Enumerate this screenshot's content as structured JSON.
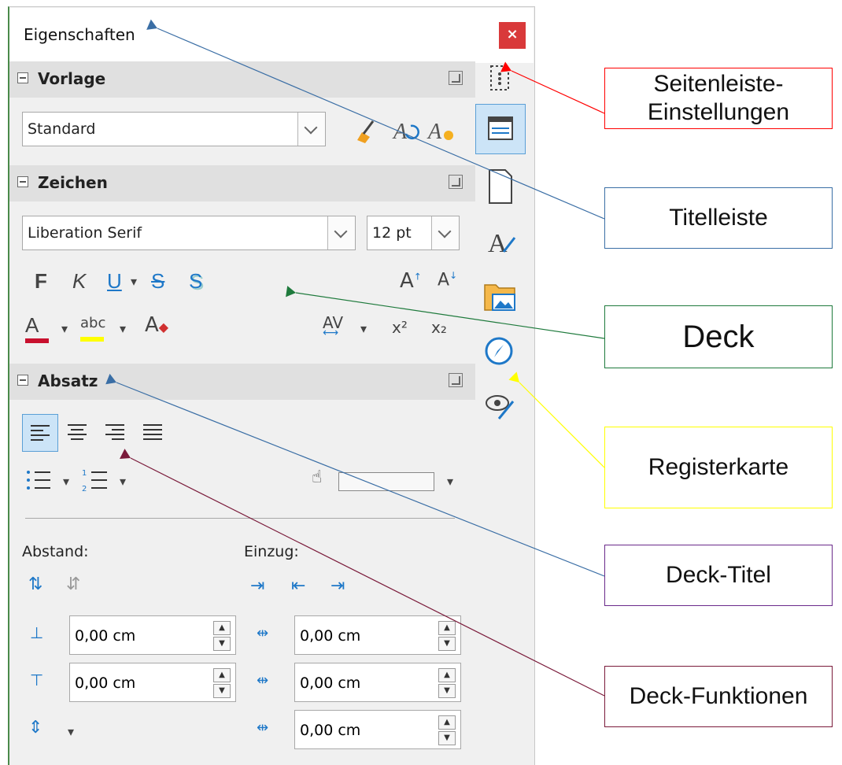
{
  "window": {
    "title": "Eigenschaften",
    "close_label": "×"
  },
  "sections": {
    "vorlage": {
      "label": "Vorlage",
      "style_value": "Standard"
    },
    "zeichen": {
      "label": "Zeichen",
      "font_value": "Liberation Serif",
      "size_value": "12 pt",
      "bold": "F",
      "italic": "K",
      "underline": "U",
      "strike": "S",
      "shadow": "S",
      "superscript": "x²",
      "subscript": "x₂"
    },
    "absatz": {
      "label": "Absatz",
      "abstand_label": "Abstand:",
      "einzug_label": "Einzug:",
      "spacing_above": "0,00 cm",
      "spacing_below": "0,00 cm",
      "indent_before": "0,00 cm",
      "indent_after": "0,00 cm",
      "indent_first": "0,00 cm"
    }
  },
  "callouts": {
    "seitenleiste": "Seitenleiste-\nEinstellungen",
    "titelleiste": "Titelleiste",
    "deck": "Deck",
    "registerkarte": "Registerkarte",
    "deck_titel": "Deck-Titel",
    "deck_funktionen": "Deck-Funktionen"
  },
  "colors": {
    "close": "#d9393a",
    "accent": "#1e78c8",
    "red": "#ff0000",
    "blue": "#3a6ea5",
    "green": "#1e7a3c",
    "yellow": "#ffff00",
    "purple": "#6a2a8a",
    "maroon": "#7a1a3a"
  }
}
